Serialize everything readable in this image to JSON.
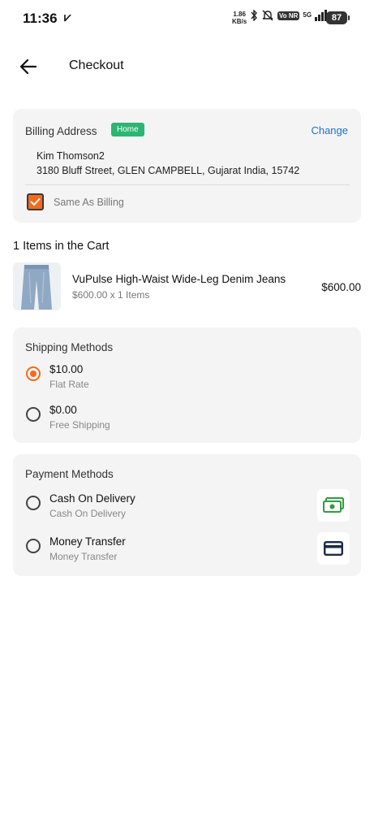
{
  "status_bar": {
    "time": "11:36",
    "network_speed_value": "1.86",
    "network_speed_unit": "KB/s",
    "network_badge": "Vo NR",
    "signal_label": "5G",
    "battery": "87"
  },
  "header": {
    "title": "Checkout"
  },
  "billing": {
    "title": "Billing Address",
    "badge": "Home",
    "change_label": "Change",
    "name": "Kim Thomson2",
    "address": "3180 Bluff Street, GLEN CAMPBELL, Gujarat India, 15742",
    "same_as_billing_label": "Same As Billing",
    "same_as_billing_checked": true
  },
  "cart": {
    "title": "1 Items in the Cart",
    "items": [
      {
        "name": "VuPulse High-Waist Wide-Leg Denim Jeans",
        "subtitle": "$600.00 x 1 Items",
        "price": "$600.00"
      }
    ]
  },
  "shipping": {
    "title": "Shipping Methods",
    "options": [
      {
        "price": "$10.00",
        "label": "Flat Rate",
        "selected": true
      },
      {
        "price": "$0.00",
        "label": "Free Shipping",
        "selected": false
      }
    ]
  },
  "payment": {
    "title": "Payment Methods",
    "options": [
      {
        "label": "Cash On Delivery",
        "sub": "Cash On Delivery",
        "icon": "cash-icon",
        "selected": false
      },
      {
        "label": "Money Transfer",
        "sub": "Money Transfer",
        "icon": "card-icon",
        "selected": false
      }
    ]
  },
  "colors": {
    "accent": "#f26b1d",
    "badge_green": "#2bb673",
    "link_blue": "#1a73c9",
    "card_bg": "#f4f4f4",
    "cash_green": "#2f9e3f",
    "card_navy": "#1b2a4a"
  }
}
